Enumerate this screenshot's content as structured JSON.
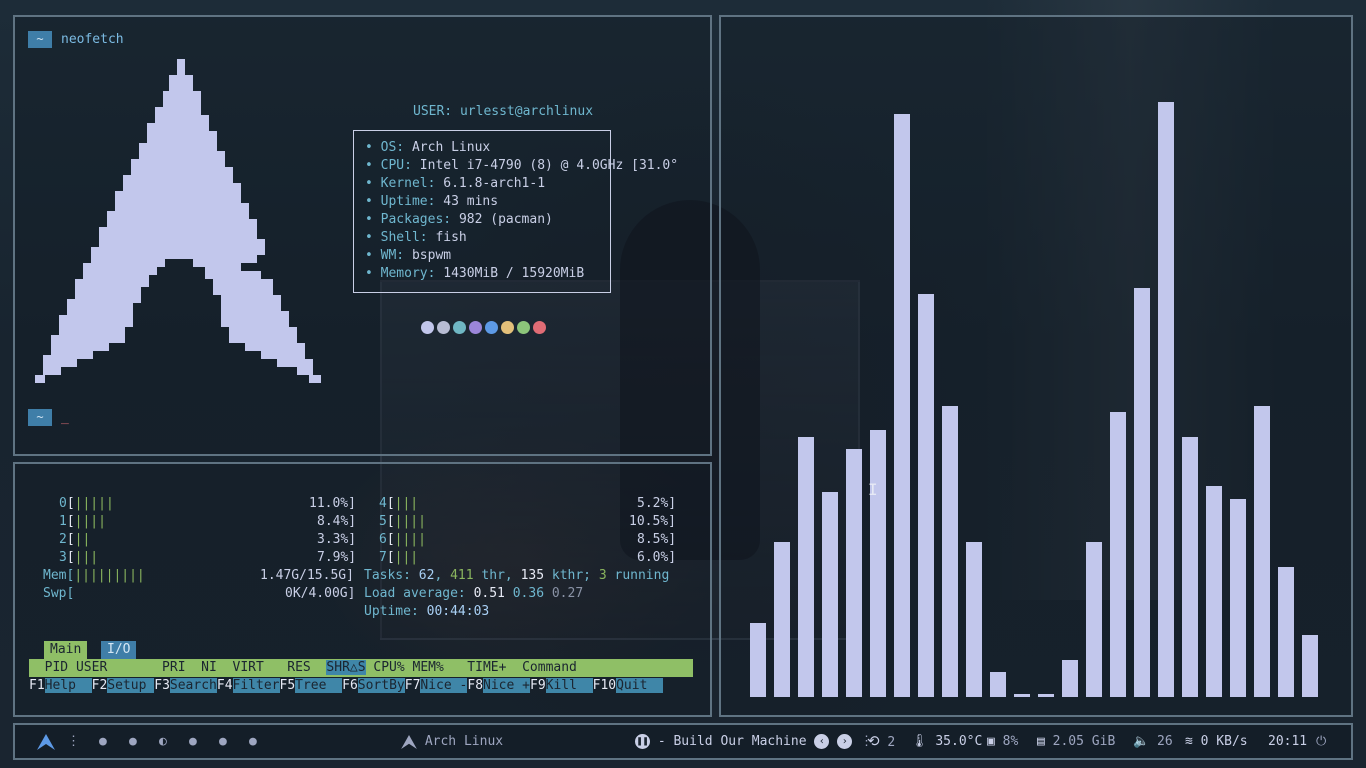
{
  "terminal": {
    "prompt_symbol": "~",
    "command": "neofetch",
    "cursor": "_",
    "neofetch": {
      "user_key": "USER:",
      "user_value": "urlesst@archlinux",
      "bullet": "•",
      "rows": [
        {
          "key": "OS:",
          "value": "Arch Linux"
        },
        {
          "key": "CPU:",
          "value": "Intel i7-4790 (8) @ 4.0GHz [31.0°"
        },
        {
          "key": "Kernel:",
          "value": "6.1.8-arch1-1"
        },
        {
          "key": "Uptime:",
          "value": "43 mins"
        },
        {
          "key": "Packages:",
          "value": "982 (pacman)"
        },
        {
          "key": "Shell:",
          "value": "fish"
        },
        {
          "key": "WM:",
          "value": "bspwm"
        },
        {
          "key": "Memory:",
          "value": "1430MiB / 15920MiB"
        }
      ],
      "swatches": [
        "#c2c7ec",
        "#b8bdd4",
        "#6fb7c4",
        "#9b86d9",
        "#5d9ae6",
        "#e3c07a",
        "#8cc57a",
        "#e06c75"
      ]
    }
  },
  "htop": {
    "cpus": [
      {
        "id": "0",
        "bars": "|||||",
        "pct": "11.0%]"
      },
      {
        "id": "1",
        "bars": "||||",
        "pct": "8.4%]"
      },
      {
        "id": "2",
        "bars": "||",
        "pct": "3.3%]"
      },
      {
        "id": "3",
        "bars": "|||",
        "pct": "7.9%]"
      },
      {
        "id": "4",
        "bars": "|||",
        "pct": "5.2%]"
      },
      {
        "id": "5",
        "bars": "||||",
        "pct": "10.5%]"
      },
      {
        "id": "6",
        "bars": "||||",
        "pct": "8.5%]"
      },
      {
        "id": "7",
        "bars": "|||",
        "pct": "6.0%]"
      }
    ],
    "mem_label": "Mem[",
    "mem_bars": "|||||||||",
    "mem_value": "1.47G/15.5G]",
    "swp_label": "Swp[",
    "swp_value": "0K/4.00G]",
    "tasks_label": "Tasks:",
    "tasks": "62",
    "threads": "411",
    "thr_label": "thr,",
    "kthr": "135",
    "kthr_label": "kthr;",
    "running": "3",
    "running_label": "running",
    "load_label": "Load average:",
    "load1": "0.51",
    "load5": "0.36",
    "load15": "0.27",
    "uptime_label": "Uptime:",
    "uptime": "00:44:03",
    "tab_main": "Main",
    "tab_io": "I/O",
    "header_left": "  PID USER       PRI  NI  VIRT   RES  ",
    "header_sort": "SHR△S",
    "header_right": " CPU% MEM%   TIME+  Command               ",
    "fkeys": [
      {
        "key": "F1",
        "label": "Help  "
      },
      {
        "key": "F2",
        "label": "Setup "
      },
      {
        "key": "F3",
        "label": "Search"
      },
      {
        "key": "F4",
        "label": "Filter"
      },
      {
        "key": "F5",
        "label": "Tree  "
      },
      {
        "key": "F6",
        "label": "SortBy"
      },
      {
        "key": "F7",
        "label": "Nice -"
      },
      {
        "key": "F8",
        "label": "Nice +"
      },
      {
        "key": "F9",
        "label": "Kill  "
      },
      {
        "key": "F10",
        "label": "Quit  "
      }
    ]
  },
  "visualizer": {
    "levels": [
      0.12,
      0.25,
      0.42,
      0.33,
      0.4,
      0.43,
      0.94,
      0.65,
      0.47,
      0.25,
      0.04,
      0.005,
      0.005,
      0.06,
      0.25,
      0.46,
      0.66,
      0.96,
      0.42,
      0.34,
      0.32,
      0.47,
      0.21,
      0.1
    ],
    "color": "#c2c7ec"
  },
  "taskbar": {
    "workspaces": [
      "●",
      "●",
      "◐",
      "●",
      "●",
      "●"
    ],
    "window_title": "Arch Linux",
    "media_title": "- Build Our Machine",
    "updates": "2",
    "temperature": "35.0°C",
    "cpu": "8%",
    "memory": "2.05 GiB",
    "volume": "26",
    "network": "0 KB/s",
    "time": "20:11"
  }
}
